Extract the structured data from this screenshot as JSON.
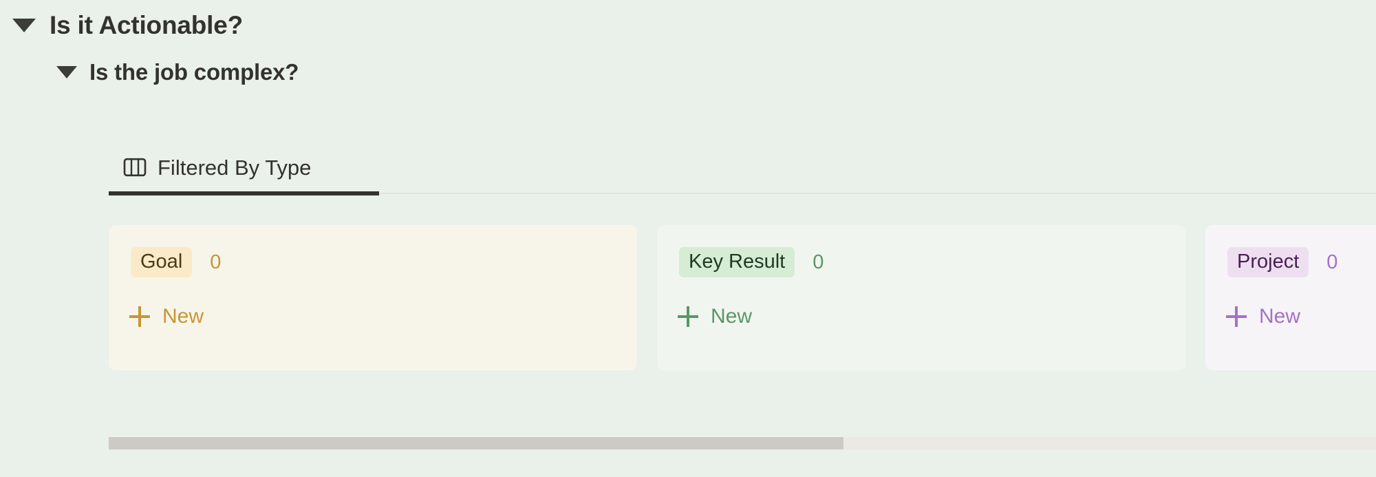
{
  "page": {
    "background_color": "#eaf0ea"
  },
  "outline": {
    "level1": {
      "caret_icon": "caret-down-icon",
      "label": "Is it Actionable?",
      "expanded": true
    },
    "level2": {
      "caret_icon": "caret-down-icon",
      "label": "Is the job complex?",
      "expanded": true
    }
  },
  "tabs": {
    "items": [
      {
        "icon": "board-columns-icon",
        "label": "Filtered By Type",
        "active": true
      }
    ],
    "active_index": 0,
    "active_underline_color": "#33332e"
  },
  "board": {
    "columns": [
      {
        "badge_label": "Goal",
        "count": "0",
        "new_label": "New",
        "new_icon": "plus-icon",
        "card_bg": "#f7f5ea",
        "badge_bg": "#fbeac8",
        "badge_text_color": "#4a3a17",
        "accent_color": "#c89536"
      },
      {
        "badge_label": "Key Result",
        "count": "0",
        "new_label": "New",
        "new_icon": "plus-icon",
        "card_bg": "#f1f5ef",
        "badge_bg": "#d6ecd4",
        "badge_text_color": "#1f3a22",
        "accent_color": "#5b9668"
      },
      {
        "badge_label": "Project",
        "count": "0",
        "new_label": "New",
        "new_icon": "plus-icon",
        "card_bg": "#f7f4f8",
        "badge_bg": "#eddff0",
        "badge_text_color": "#4a1f52",
        "accent_color": "#a472c4"
      }
    ]
  },
  "scrollbar": {
    "orientation": "horizontal",
    "track_color": "#ece9e5",
    "thumb_color": "#cdcac5",
    "thumb_position_pct": 0,
    "thumb_width_pct": 58
  }
}
